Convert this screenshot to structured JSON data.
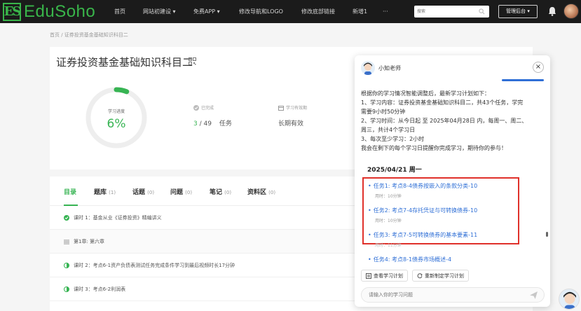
{
  "nav": {
    "logo_mark": "ES",
    "logo_text": "EduSoho",
    "items": [
      "首页",
      "网站初建设 ▾",
      "免费APP ▾",
      "修改导航和LOGO",
      "修改底部链接",
      "新增1",
      "···"
    ],
    "search_placeholder": "搜索",
    "admin_label": "管理后台 ▾"
  },
  "breadcrumb": "首页 / 证券投资基金基础知识科目二",
  "course": {
    "title": "证券投资基金基础知识科目二",
    "progress_label": "学习进度",
    "progress_value": "6%",
    "progress_fraction": 0.06,
    "completed_label": "已完成",
    "completed_count": "3",
    "completed_total": "/ 49",
    "task_unit": "任务",
    "validity_label": "学习有效期",
    "validity_value": "长期有效"
  },
  "tabs": [
    {
      "label": "目录",
      "count": ""
    },
    {
      "label": "题库",
      "count": "(1)"
    },
    {
      "label": "话题",
      "count": "(0)"
    },
    {
      "label": "问题",
      "count": "(0)"
    },
    {
      "label": "笔记",
      "count": "(0)"
    },
    {
      "label": "资料区",
      "count": "(0)"
    }
  ],
  "lessons": [
    {
      "text": "课时 1：基金从业《证券投资》精编讲义"
    },
    {
      "text": "第1章: 第六章"
    },
    {
      "text": "课时 2：考点6-1资产负债表测试任务完成条件学习到最后视频时长17分钟"
    },
    {
      "text": "课时 3：考点6-2利润表"
    }
  ],
  "chat": {
    "teacher_name": "小知老师",
    "close": "×",
    "lines": [
      "根据你的学习情况智能调整后，最新学习计划如下：",
      "1、学习内容：证券投资基金基础知识科目二，共43个任务，学完",
      "需要9小时50分钟",
      "2、学习时间：从今日起 至 2025年04月28日 内，每周一、周二、",
      "周三，共计4个学习日",
      "3、每次至少学习：2小时",
      "我会在剩下的每个学习日提醒你完成学习，期待你的参与！"
    ],
    "date": "2025/04/21 周一",
    "tasks": [
      {
        "title": "任务1: 考点8-4债券按嵌入的条款分类-10",
        "duration": "用时：10分钟"
      },
      {
        "title": "任务2: 考点7-4存托凭证与可转换债券-10",
        "duration": "用时：10分钟"
      },
      {
        "title": "任务3: 考点7-5可转换债券的基本要素-11",
        "duration": "用时：11分钟"
      },
      {
        "title": "任务4: 考点8-1债券市场概述-4",
        "duration": ""
      }
    ],
    "view_plan_label": "查看学习计划",
    "replan_label": "重新制定学习计划",
    "input_placeholder": "请输入你的学习问题"
  },
  "colors": {
    "accent": "#37b453",
    "link": "#2f6fd6",
    "highlight": "#e0312b",
    "nav_bg": "#1b1b1b"
  }
}
